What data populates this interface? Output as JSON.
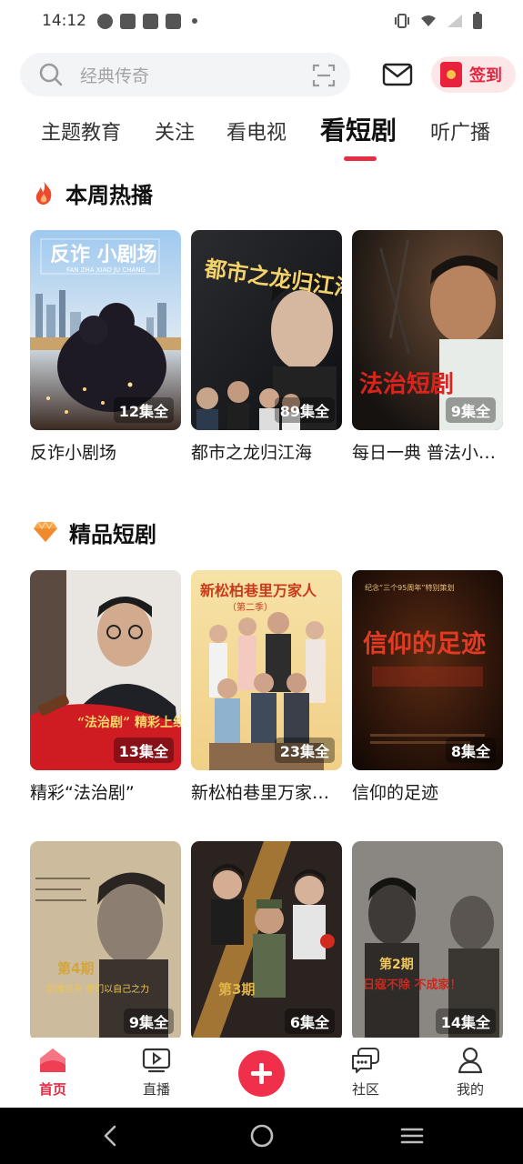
{
  "status_bar": {
    "time": "14:12"
  },
  "search": {
    "placeholder": "经典传奇"
  },
  "header": {
    "signin_label": "签到"
  },
  "tabs": [
    {
      "label": "主题教育",
      "active": false
    },
    {
      "label": "关注",
      "active": false
    },
    {
      "label": "看电视",
      "active": false
    },
    {
      "label": "看短剧",
      "active": true
    },
    {
      "label": "听广播",
      "active": false
    }
  ],
  "sections": [
    {
      "title": "本周热播",
      "icon": "flame-icon",
      "items": [
        {
          "title": "反诈小剧场",
          "episodes": "12集全",
          "poster_text": "反诈 小剧场",
          "poster_sub": "FAN ZHA XIAO JU CHANG"
        },
        {
          "title": "都市之龙归江海",
          "episodes": "89集全",
          "poster_text": "都市之龙归江海"
        },
        {
          "title": "每日一典 普法小剧场",
          "episodes": "9集全",
          "poster_text": "法治短剧"
        }
      ]
    },
    {
      "title": "精品短剧",
      "icon": "gem-icon",
      "items": [
        {
          "title": "精彩“法治剧”",
          "episodes": "13集全",
          "poster_text": "“法治剧” 精彩上线"
        },
        {
          "title": "新松柏巷里万家人（第二季）",
          "episodes": "23集全",
          "poster_text": "新松柏巷里万家人",
          "poster_sub": "（第二季）"
        },
        {
          "title": "信仰的足迹",
          "episodes": "8集全",
          "poster_text": "信仰的足迹",
          "poster_sub": "纪念“三个95周年”特别策划"
        }
      ]
    },
    {
      "title": "",
      "icon": "",
      "items": [
        {
          "title": "",
          "episodes": "9集全",
          "poster_text": "第4期",
          "poster_sub": "国难当头 他们以自己之力"
        },
        {
          "title": "",
          "episodes": "6集全",
          "poster_text": "第3期"
        },
        {
          "title": "",
          "episodes": "14集全",
          "poster_text": "第2期",
          "poster_sub": "日寇不除 不成家！"
        }
      ]
    }
  ],
  "bottom_nav": [
    {
      "label": "首页",
      "icon": "home-icon",
      "active": true
    },
    {
      "label": "直播",
      "icon": "live-tv-icon",
      "active": false
    },
    {
      "label": "",
      "icon": "plus-icon",
      "active": false
    },
    {
      "label": "社区",
      "icon": "chat-bubble-icon",
      "active": false
    },
    {
      "label": "我的",
      "icon": "profile-icon",
      "active": false
    }
  ],
  "colors": {
    "accent": "#e52e43",
    "search_bg": "#f3f4f6",
    "signin_bg": "#fde6e8"
  }
}
